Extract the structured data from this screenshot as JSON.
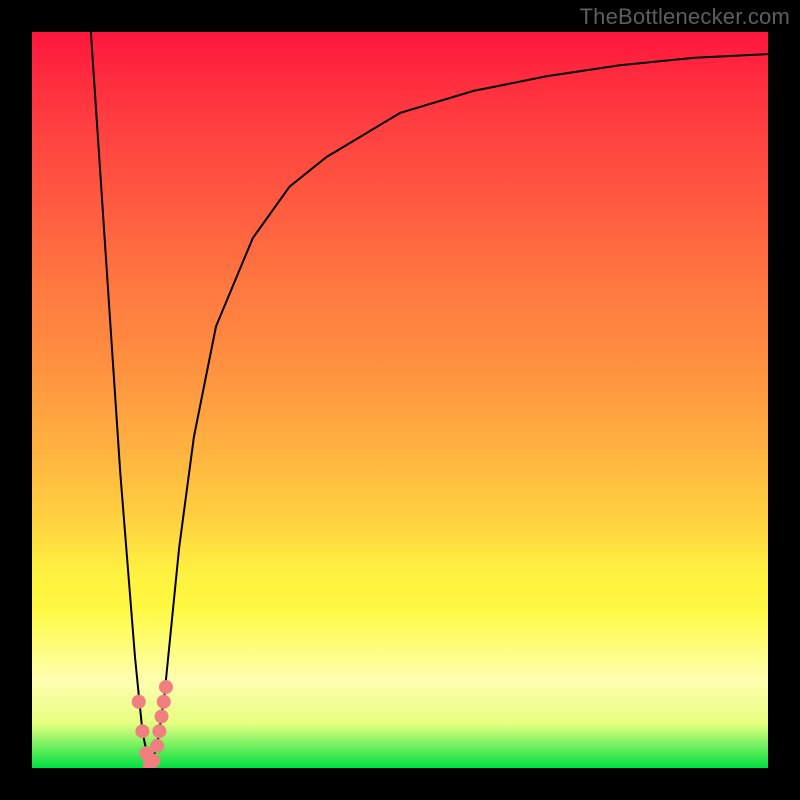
{
  "attribution": "TheBottlenecker.com",
  "chart_data": {
    "type": "line",
    "title": "",
    "xlabel": "",
    "ylabel": "",
    "xlim": [
      0,
      100
    ],
    "ylim": [
      0,
      100
    ],
    "series": [
      {
        "name": "bottleneck-curve",
        "x": [
          8,
          10,
          12,
          14,
          15,
          16,
          17,
          18,
          19,
          20,
          22,
          25,
          30,
          35,
          40,
          50,
          60,
          70,
          80,
          90,
          100
        ],
        "y": [
          100,
          70,
          40,
          15,
          5,
          0,
          3,
          10,
          20,
          30,
          45,
          60,
          72,
          79,
          83,
          89,
          92,
          94,
          95.5,
          96.5,
          97
        ]
      }
    ],
    "markers": {
      "name": "highlight-dots",
      "color": "#f08080",
      "points": [
        {
          "x": 14.5,
          "y": 9
        },
        {
          "x": 15.0,
          "y": 5
        },
        {
          "x": 15.5,
          "y": 2
        },
        {
          "x": 16.0,
          "y": 0.5
        },
        {
          "x": 16.5,
          "y": 1
        },
        {
          "x": 17.0,
          "y": 3
        },
        {
          "x": 17.3,
          "y": 5
        },
        {
          "x": 17.6,
          "y": 7
        },
        {
          "x": 17.9,
          "y": 9
        },
        {
          "x": 18.2,
          "y": 11
        }
      ]
    },
    "gradient_stops": [
      {
        "pos": 0,
        "color": "#ff163e"
      },
      {
        "pos": 13,
        "color": "#ff4040"
      },
      {
        "pos": 45,
        "color": "#ff9040"
      },
      {
        "pos": 73,
        "color": "#fff040"
      },
      {
        "pos": 88,
        "color": "#fffeb0"
      },
      {
        "pos": 100,
        "color": "#00e040"
      }
    ]
  }
}
